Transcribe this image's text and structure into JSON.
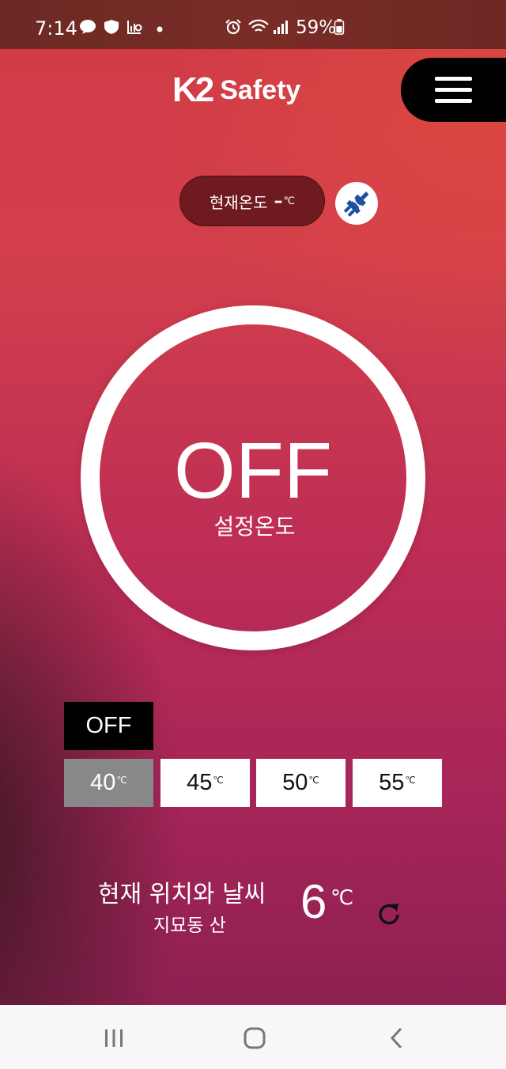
{
  "status_bar": {
    "time": "7:14",
    "battery": "59%",
    "icons": [
      "talk-icon",
      "en-icon",
      "chart-search-icon",
      "dot-icon",
      "alarm-icon",
      "wifi-icon",
      "signal-icon",
      "battery-icon"
    ]
  },
  "header": {
    "logo_k2": "K2",
    "logo_safety": "Safety"
  },
  "current_temp": {
    "label": "현재온도",
    "value": "–",
    "unit": "℃"
  },
  "dial": {
    "state": "OFF",
    "label": "설정온도"
  },
  "selector": {
    "off_label": "OFF",
    "options": [
      {
        "value": "40",
        "unit": "℃"
      },
      {
        "value": "45",
        "unit": "℃"
      },
      {
        "value": "50",
        "unit": "℃"
      },
      {
        "value": "55",
        "unit": "℃"
      }
    ],
    "selected": "40"
  },
  "weather": {
    "title": "현재 위치와 날씨",
    "location": "지묘동 산",
    "temp": "6",
    "unit": "℃"
  },
  "colors": {
    "accent": "#cf3a45",
    "pill": "#6f1a1f",
    "selected_option": "#888888",
    "plug": "#1d4fa3"
  }
}
